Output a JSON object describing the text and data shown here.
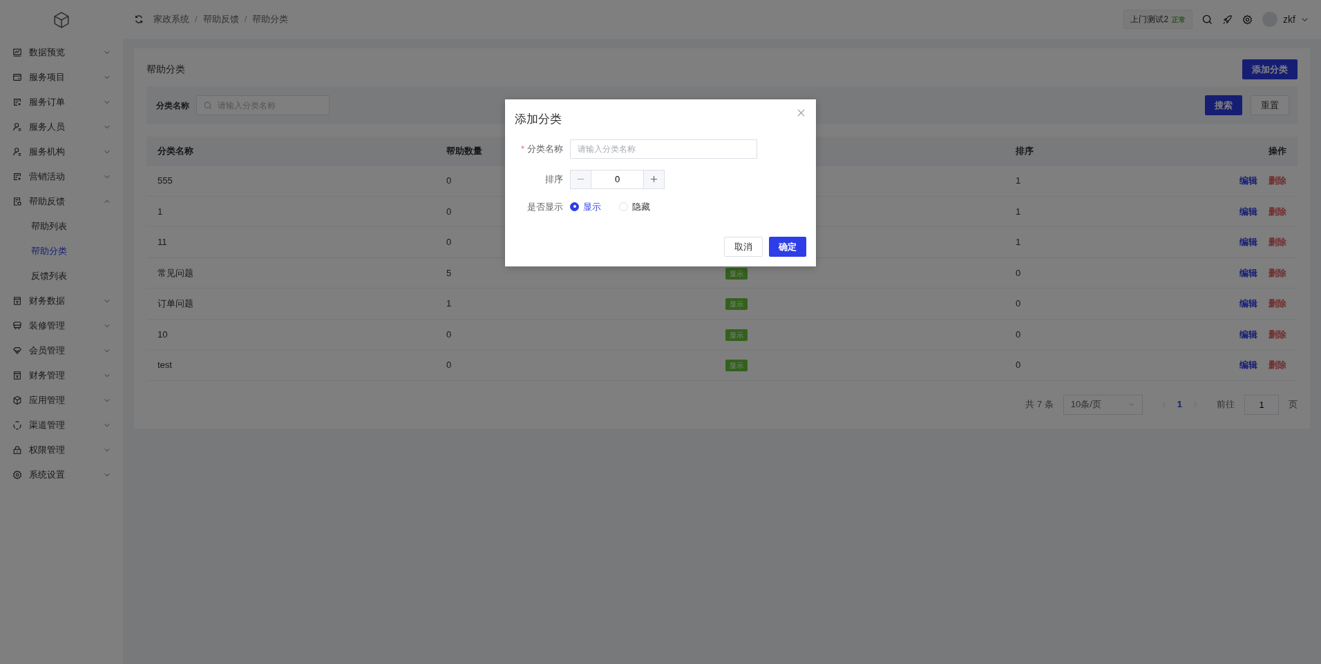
{
  "sidebar": {
    "items": [
      {
        "label": "数据预览",
        "expanded": false
      },
      {
        "label": "服务项目",
        "expanded": false
      },
      {
        "label": "服务订单",
        "expanded": false
      },
      {
        "label": "服务人员",
        "expanded": false
      },
      {
        "label": "服务机构",
        "expanded": false
      },
      {
        "label": "营销活动",
        "expanded": false
      },
      {
        "label": "帮助反馈",
        "expanded": true,
        "children": [
          {
            "label": "帮助列表",
            "selected": false
          },
          {
            "label": "帮助分类",
            "selected": true
          },
          {
            "label": "反馈列表",
            "selected": false
          }
        ]
      },
      {
        "label": "财务数据",
        "expanded": false
      },
      {
        "label": "装修管理",
        "expanded": false
      },
      {
        "label": "会员管理",
        "expanded": false
      },
      {
        "label": "财务管理",
        "expanded": false
      },
      {
        "label": "应用管理",
        "expanded": false
      },
      {
        "label": "渠道管理",
        "expanded": false
      },
      {
        "label": "权限管理",
        "expanded": false
      },
      {
        "label": "系统设置",
        "expanded": false
      }
    ]
  },
  "header": {
    "breadcrumb": [
      {
        "label": "家政系统",
        "separator": "/"
      },
      {
        "label": "帮助反馈",
        "separator": "/"
      },
      {
        "label": "帮助分类"
      }
    ],
    "store": {
      "name": "上门测试2",
      "status": "正常"
    },
    "user": {
      "name": "zkf"
    }
  },
  "page": {
    "title": "帮助分类",
    "add_button": "添加分类",
    "filter": {
      "label": "分类名称",
      "placeholder": "请输入分类名称",
      "search_button": "搜索",
      "reset_button": "重置"
    },
    "table": {
      "columns": {
        "name": "分类名称",
        "count": "帮助数量",
        "sort": "排序",
        "actions": "操作"
      },
      "rows": [
        {
          "name": "555",
          "count": "0",
          "sort": "1",
          "edit": "编辑",
          "delete": "删除"
        },
        {
          "name": "1",
          "count": "0",
          "sort": "1",
          "edit": "编辑",
          "delete": "删除"
        },
        {
          "name": "11",
          "count": "0",
          "sort": "1",
          "edit": "编辑",
          "delete": "删除"
        },
        {
          "name": "常见问题",
          "count": "5",
          "status": "显示",
          "sort": "0",
          "edit": "编辑",
          "delete": "删除"
        },
        {
          "name": "订单问题",
          "count": "1",
          "status": "显示",
          "sort": "0",
          "edit": "编辑",
          "delete": "删除"
        },
        {
          "name": "10",
          "count": "0",
          "status": "显示",
          "sort": "0",
          "edit": "编辑",
          "delete": "删除"
        },
        {
          "name": "test",
          "count": "0",
          "status": "显示",
          "sort": "0",
          "edit": "编辑",
          "delete": "删除"
        }
      ]
    },
    "pagination": {
      "total": "共 7 条",
      "page_size": "10条/页",
      "pages": [
        {
          "label": "1",
          "selected": true
        }
      ],
      "goto_label": "前往",
      "goto_value": "1",
      "page_unit": "页"
    }
  },
  "dialog": {
    "title": "添加分类",
    "name_field": {
      "label": "分类名称",
      "required_mark": "*",
      "placeholder": "请输入分类名称"
    },
    "sort_field": {
      "label": "排序",
      "value": "0"
    },
    "display_field": {
      "label": "是否显示",
      "options": [
        {
          "label": "显示",
          "selected": true
        },
        {
          "label": "隐藏",
          "selected": false
        }
      ]
    },
    "cancel_button": "取消",
    "confirm_button": "确定"
  }
}
